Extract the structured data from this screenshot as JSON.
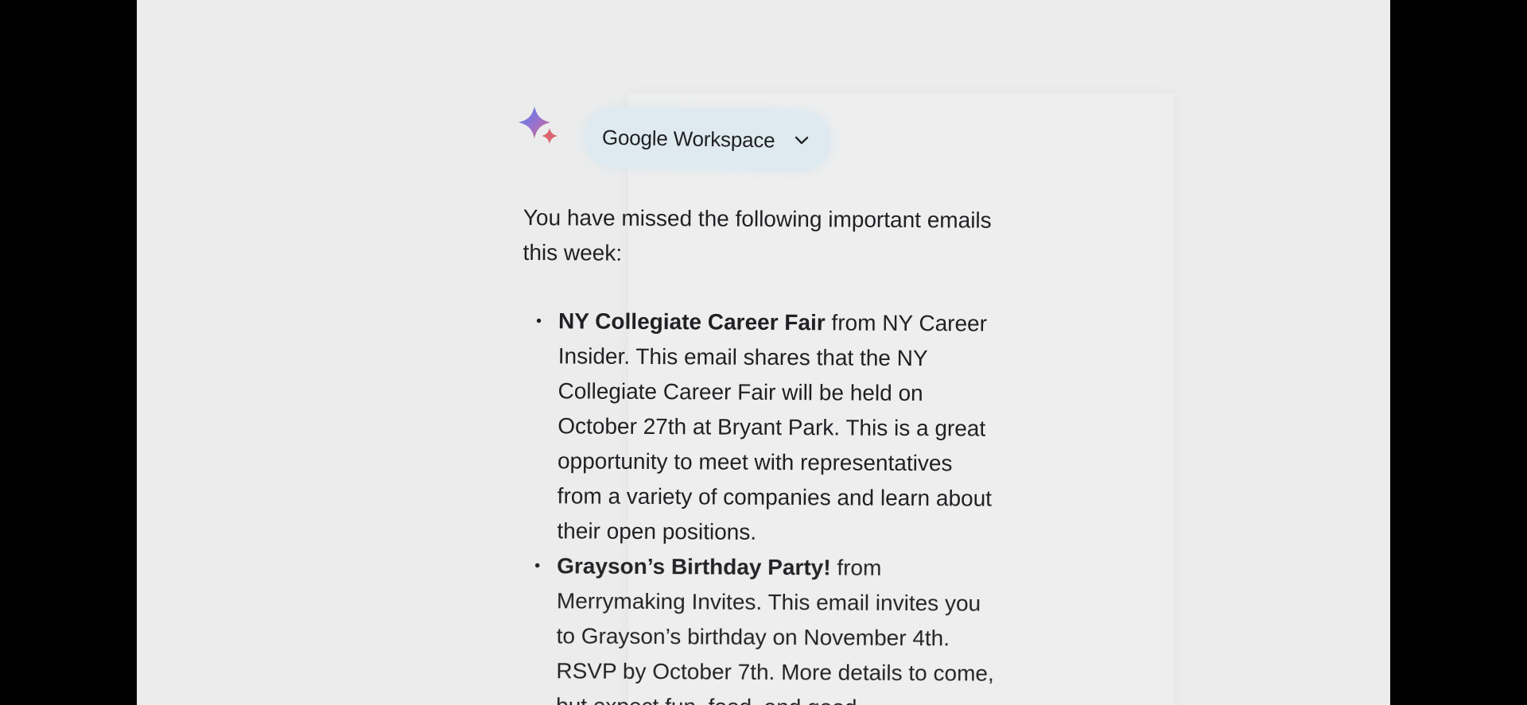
{
  "assistant": {
    "icon": "gemini-sparkle-icon",
    "workspace_button": {
      "label": "Google Workspace",
      "icon": "chevron-down-icon",
      "background_color": "#dfeaf0"
    }
  },
  "message": {
    "intro": "You have missed the following important emails this week:",
    "emails": [
      {
        "title": "NY Collegiate Career Fair",
        "description": " from NY Career Insider. This email shares that the NY Collegiate Career Fair will be held on October 27th at Bryant Park. This is a great opportunity to meet with representatives from a variety of companies and learn about their open positions."
      },
      {
        "title": "Grayson’s Birthday Party!",
        "description": " from Merrymaking Invites. This email invites you to Grayson’s birthday on November 4th. RSVP by October 7th. More details to come, but expect fun, food, and good"
      }
    ]
  },
  "colors": {
    "page_background": "#ececec",
    "letterbox": "#000000",
    "text": "#202124",
    "sparkle_blue": "#4f7df3",
    "sparkle_purple": "#9b72cb",
    "sparkle_pink": "#d96570"
  }
}
